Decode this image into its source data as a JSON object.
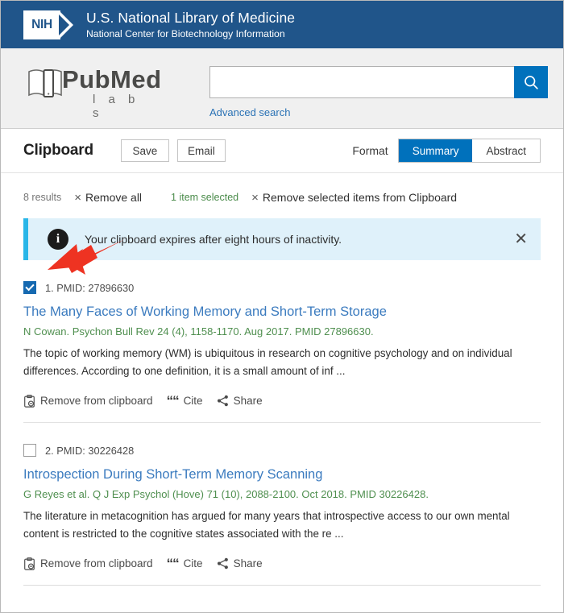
{
  "nih": {
    "logo_text": "NIH",
    "title": "U.S. National Library of Medicine",
    "subtitle": "National Center for Biotechnology Information"
  },
  "brand": {
    "name": "PubMed",
    "sub": "l a b s",
    "book_icon": "open-book-icon"
  },
  "search": {
    "value": "",
    "placeholder": "",
    "button_icon": "search-icon",
    "advanced_link": "Advanced search"
  },
  "toolbar": {
    "title": "Clipboard",
    "save_label": "Save",
    "email_label": "Email",
    "format_label": "Format",
    "format_options": [
      "Summary",
      "Abstract"
    ],
    "format_selected": "Summary"
  },
  "results_bar": {
    "count_label": "8 results",
    "remove_all_label": "Remove all",
    "selected_label": "1 item selected",
    "remove_selected_label": "Remove selected items from Clipboard",
    "x_glyph": "×"
  },
  "banner": {
    "icon": "info-icon",
    "message": "Your clipboard expires after eight hours of inactivity.",
    "close_glyph": "✕",
    "accent_color": "#29b6e8",
    "background_color": "#dff1fa"
  },
  "articles": [
    {
      "index_label": "1. PMID: 27896630",
      "checked": true,
      "title": "The Many Faces of Working Memory and Short-Term Storage",
      "citation": "N Cowan. Psychon Bull Rev 24 (4), 1158-1170. Aug 2017. PMID 27896630.",
      "snippet": "The topic of working memory (WM) is ubiquitous in research on cognitive psychology and on individual differences. According to one definition, it is a small amount of inf ...",
      "actions": {
        "remove_label": "Remove from clipboard",
        "cite_label": "Cite",
        "share_label": "Share"
      }
    },
    {
      "index_label": "2. PMID: 30226428",
      "checked": false,
      "title": "Introspection During Short-Term Memory Scanning",
      "citation": "G Reyes et al. Q J Exp Psychol (Hove) 71 (10), 2088-2100. Oct 2018. PMID 30226428.",
      "snippet": "The literature in metacognition has argued for many years that introspective access to our own mental content is restricted to the cognitive states associated with the re ...",
      "actions": {
        "remove_label": "Remove from clipboard",
        "cite_label": "Cite",
        "share_label": "Share"
      }
    }
  ],
  "annotation": {
    "arrow_color": "#ee3322",
    "points_to": "first-article-checkbox"
  },
  "colors": {
    "nih_blue": "#20558a",
    "accent_blue": "#0071bc",
    "link_blue": "#3b7bbf",
    "citation_green": "#4f8f4f",
    "selected_green": "#4a8b4a"
  }
}
